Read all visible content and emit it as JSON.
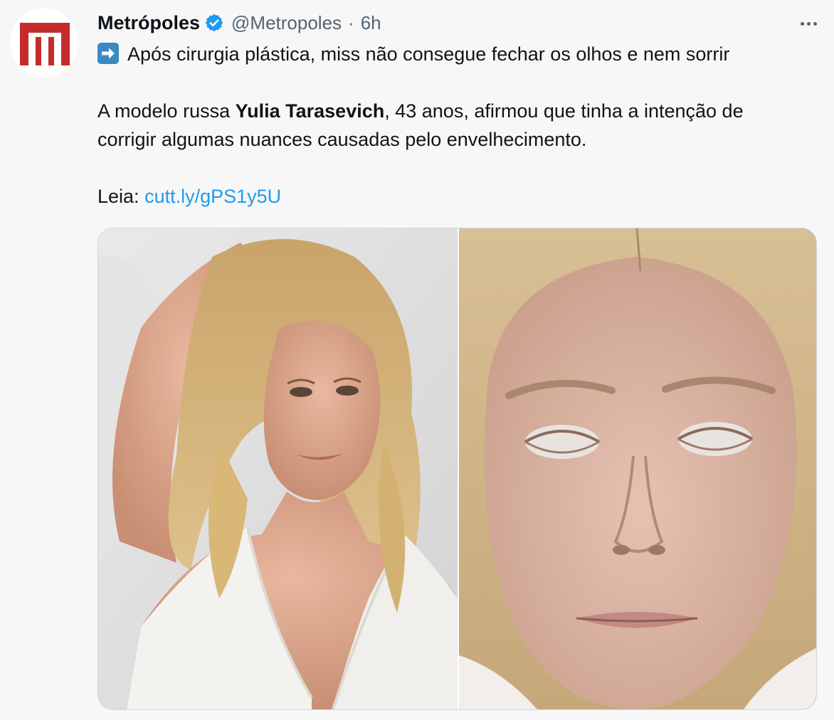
{
  "account": {
    "display_name": "Metrópoles",
    "handle": "@Metropoles",
    "separator": "·",
    "time": "6h",
    "verified": true,
    "avatar_icon": "metropoles-m-logo",
    "brand_color": "#c62b2b"
  },
  "menu": {
    "icon": "more-options-icon"
  },
  "tweet": {
    "emoji_icon": "right-arrow-emoji",
    "headline": "Após cirurgia plástica, miss não consegue fechar os olhos e nem sorrir",
    "para1_before": "A modelo russa ",
    "para1_bold": "Yulia Tarasevich",
    "para1_after_line1": ", 43 anos, afirmou que tinha a intenção de",
    "para1_line2": "corrigir algumas nuances causadas pelo envelhecimento.",
    "read_label": "Leia: ",
    "link_text": "cutt.ly/gPS1y5U"
  },
  "media": {
    "images": [
      {
        "description_icon": "photo-before-surgery"
      },
      {
        "description_icon": "photo-after-surgery"
      }
    ]
  },
  "colors": {
    "link": "#1d9bf0",
    "text": "#0f1419",
    "secondary": "#536471",
    "verified_badge": "#1d9bf0",
    "emoji_bg": "#3b88c3"
  }
}
